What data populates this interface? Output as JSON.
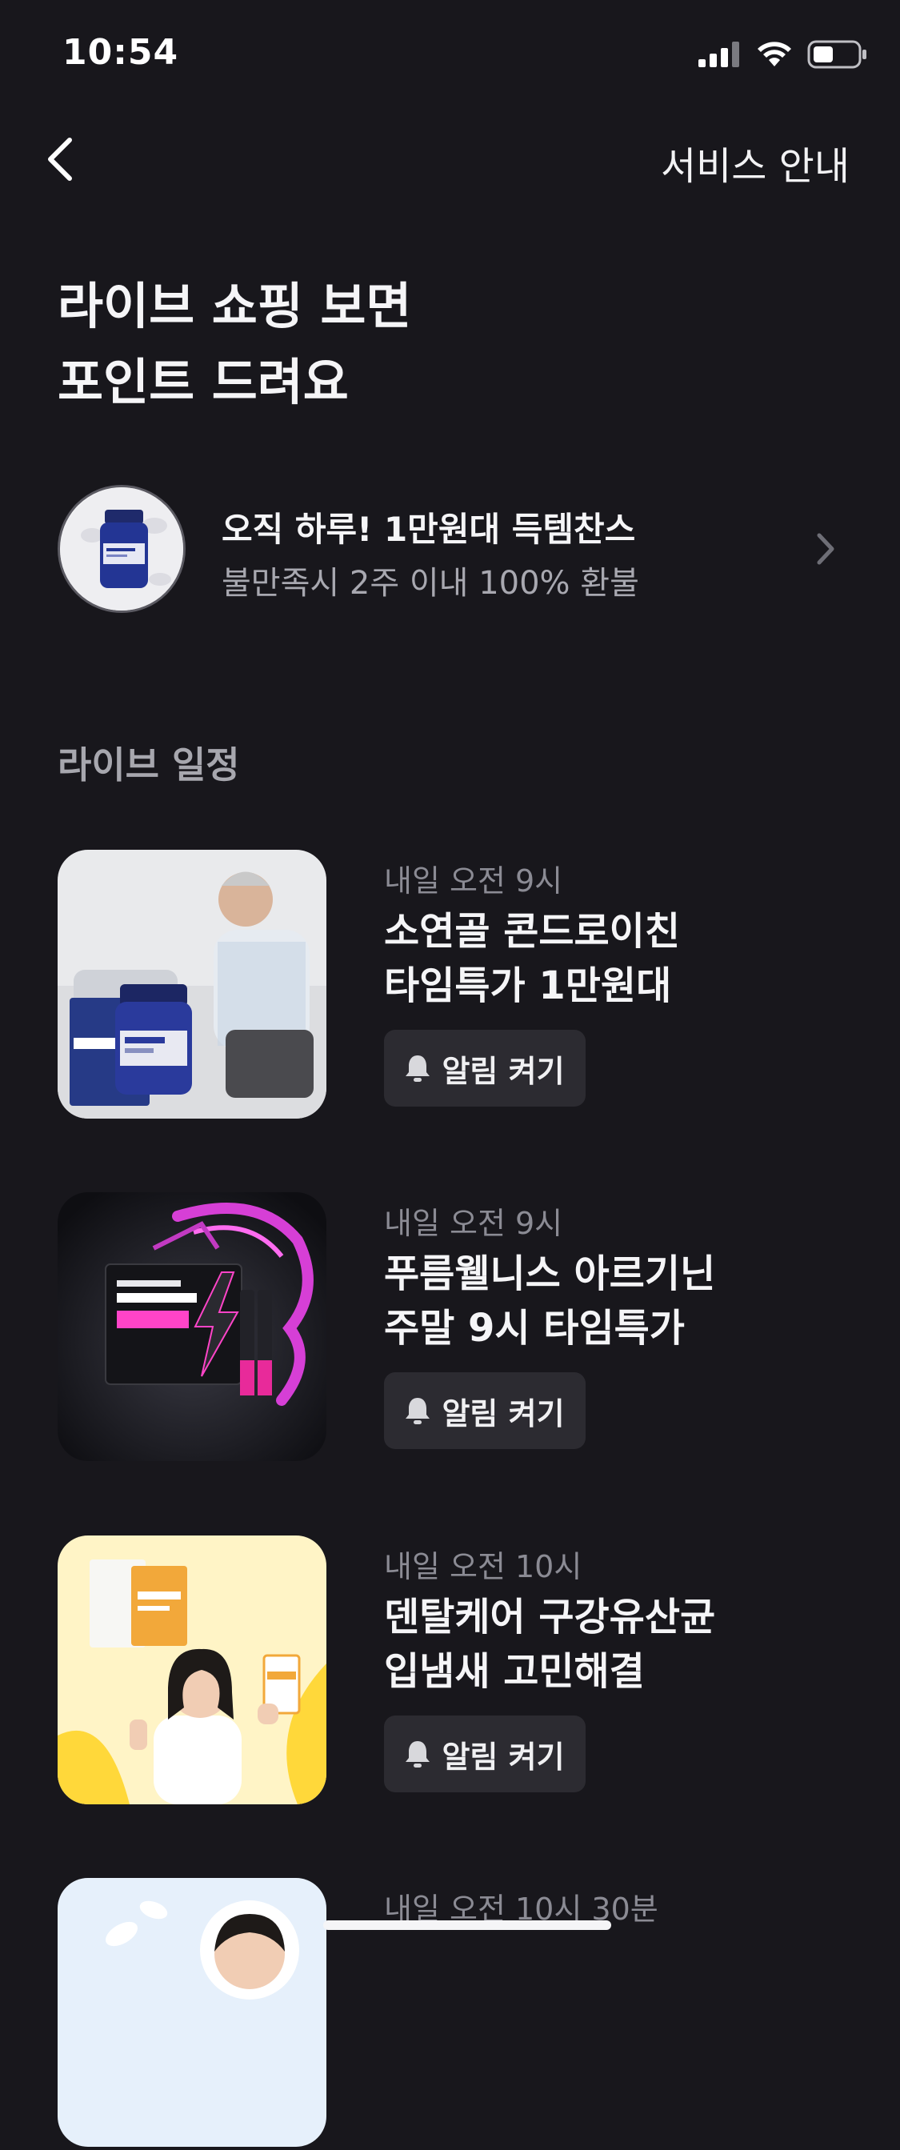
{
  "status_bar": {
    "time": "10:54"
  },
  "nav": {
    "service_label": "서비스 안내"
  },
  "hero": {
    "line1": "라이브 쇼핑 보면",
    "line2": "포인트 드려요"
  },
  "promo": {
    "title": "오직 하루! 1만원대 득템찬스",
    "subtitle": "불만족시 2주 이내 100% 환불"
  },
  "section": {
    "title": "라이브 일정"
  },
  "live_items": [
    {
      "time": "내일 오전 9시",
      "title_line1": "소연골 콘드로이친",
      "title_line2": "타임특가 1만원대",
      "alarm_label": "알림 켜기"
    },
    {
      "time": "내일 오전 9시",
      "title_line1": "푸름웰니스 아르기닌",
      "title_line2": "주말 9시 타임특가",
      "alarm_label": "알림 켜기"
    },
    {
      "time": "내일 오전 10시",
      "title_line1": "덴탈케어 구강유산균",
      "title_line2": "입냄새 고민해결",
      "alarm_label": "알림 켜기"
    },
    {
      "time": "내일 오전 10시 30분"
    }
  ],
  "colors": {
    "background": "#18171c",
    "alarm_button": "#2c2b31",
    "muted_text": "#8b8b94"
  }
}
